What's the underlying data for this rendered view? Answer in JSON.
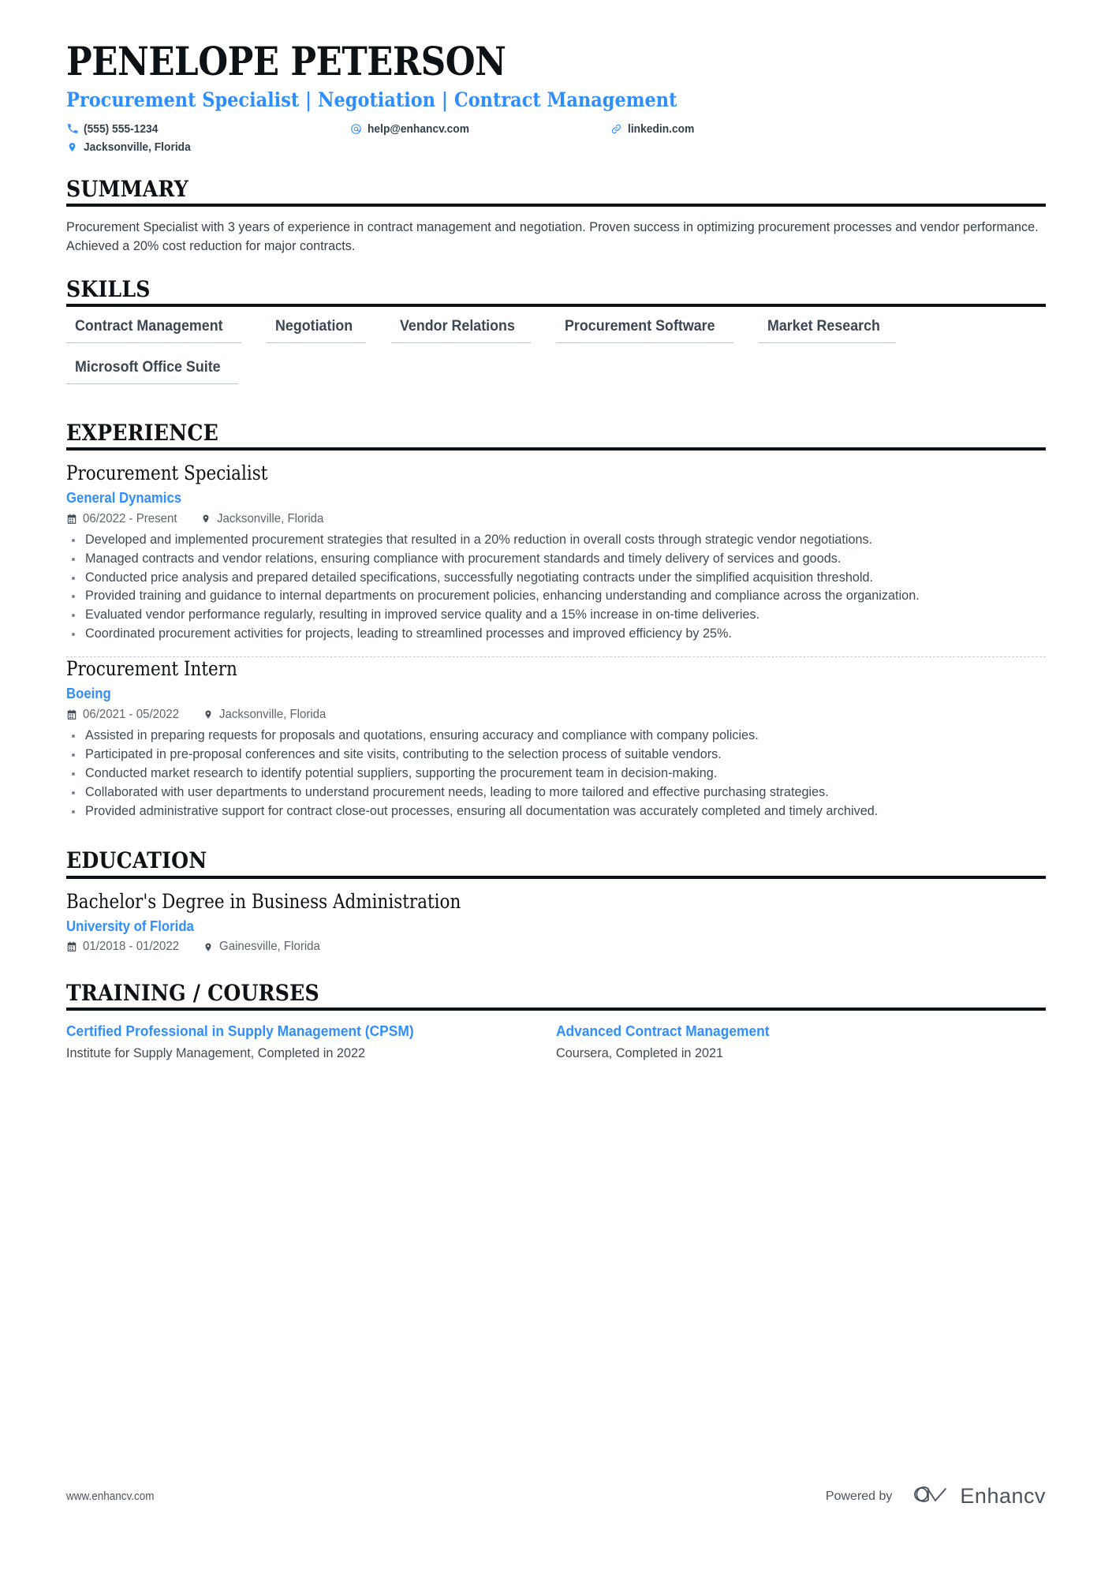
{
  "colors": {
    "accent": "#2f8eff",
    "text": "#33404d",
    "muted": "#5a6570",
    "rule": "#0d1216",
    "chip_underline": "#b8bfc6"
  },
  "header": {
    "name": "PENELOPE PETERSON",
    "headline": "Procurement Specialist | Negotiation | Contract Management",
    "contacts": [
      {
        "icon": "phone-icon",
        "value": "(555) 555-1234"
      },
      {
        "icon": "email-icon",
        "value": "help@enhancv.com"
      },
      {
        "icon": "link-icon",
        "value": "linkedin.com"
      },
      {
        "icon": "location-icon",
        "value": "Jacksonville, Florida"
      }
    ]
  },
  "sections": {
    "summary": {
      "title": "SUMMARY",
      "text": "Procurement Specialist with 3 years of experience in contract management and negotiation. Proven success in optimizing procurement processes and vendor performance. Achieved a 20% cost reduction for major contracts."
    },
    "skills": {
      "title": "SKILLS",
      "items": [
        "Contract Management",
        "Negotiation",
        "Vendor Relations",
        "Procurement Software",
        "Market Research",
        "Microsoft Office Suite"
      ]
    },
    "experience": {
      "title": "EXPERIENCE",
      "entries": [
        {
          "title": "Procurement Specialist",
          "org": "General Dynamics",
          "dates": "06/2022 - Present",
          "location": "Jacksonville, Florida",
          "bullets": [
            "Developed and implemented procurement strategies that resulted in a 20% reduction in overall costs through strategic vendor negotiations.",
            "Managed contracts and vendor relations, ensuring compliance with procurement standards and timely delivery of services and goods.",
            "Conducted price analysis and prepared detailed specifications, successfully negotiating contracts under the simplified acquisition threshold.",
            "Provided training and guidance to internal departments on procurement policies, enhancing understanding and compliance across the organization.",
            "Evaluated vendor performance regularly, resulting in improved service quality and a 15% increase in on-time deliveries.",
            "Coordinated procurement activities for projects, leading to streamlined processes and improved efficiency by 25%."
          ]
        },
        {
          "title": "Procurement Intern",
          "org": "Boeing",
          "dates": "06/2021 - 05/2022",
          "location": "Jacksonville, Florida",
          "bullets": [
            "Assisted in preparing requests for proposals and quotations, ensuring accuracy and compliance with company policies.",
            "Participated in pre-proposal conferences and site visits, contributing to the selection process of suitable vendors.",
            "Conducted market research to identify potential suppliers, supporting the procurement team in decision-making.",
            "Collaborated with user departments to understand procurement needs, leading to more tailored and effective purchasing strategies.",
            "Provided administrative support for contract close-out processes, ensuring all documentation was accurately completed and timely archived."
          ]
        }
      ]
    },
    "education": {
      "title": "EDUCATION",
      "entries": [
        {
          "title": "Bachelor's Degree in Business Administration",
          "org": "University of Florida",
          "dates": "01/2018 - 01/2022",
          "location": "Gainesville, Florida"
        }
      ]
    },
    "training": {
      "title": "TRAINING / COURSES",
      "items": [
        {
          "title": "Certified Professional in Supply Management (CPSM)",
          "sub": "Institute for Supply Management, Completed in 2022"
        },
        {
          "title": "Advanced Contract Management",
          "sub": "Coursera, Completed in 2021"
        }
      ]
    }
  },
  "footer": {
    "url": "www.enhancv.com",
    "powered_by": "Powered by",
    "brand": "Enhancv"
  }
}
